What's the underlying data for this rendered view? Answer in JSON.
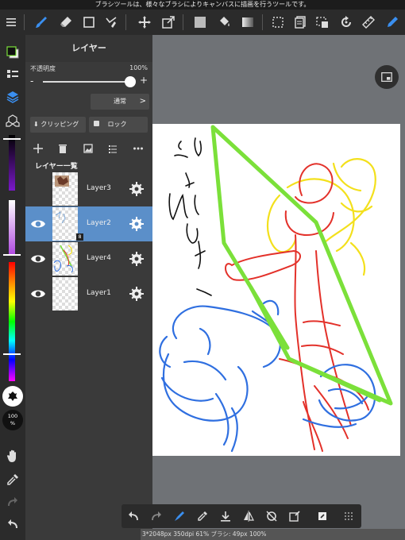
{
  "tooltip": "ブラシツールは、様々なブラシによりキャンバスに描画を行うツールです。",
  "toolbar": {
    "icons": [
      "menu-icon",
      "brush-icon",
      "eraser-icon",
      "rectangle-icon",
      "select-brush-icon",
      "move-icon",
      "transform-icon",
      "fill-color-icon",
      "bucket-icon",
      "gradient-icon",
      "select-rect-icon",
      "copy-icon",
      "select-all-icon",
      "rotate-icon",
      "ruler-icon",
      "pen-blue-icon"
    ]
  },
  "panel": {
    "title": "レイヤー",
    "opacity_label": "不透明度",
    "opacity_value": "100%",
    "opacity_level": 1.0,
    "minus": "-",
    "plus": "+",
    "blend_mode": "通常",
    "blend_chevron": ">",
    "clipping_label": "クリッピング",
    "lock_label": "ロック",
    "list_header": "レイヤー一覧",
    "layers": [
      {
        "name": "Layer3",
        "visible": false,
        "selected": false
      },
      {
        "name": "Layer2",
        "visible": true,
        "selected": true,
        "badge": "8"
      },
      {
        "name": "Layer4",
        "visible": true,
        "selected": false
      },
      {
        "name": "Layer1",
        "visible": true,
        "selected": false
      }
    ]
  },
  "leftcol": {
    "brush_size": "100\n%"
  },
  "status": "3*2048px 350dpi 61% ブラシ: 49px 100%",
  "colors": {
    "accent": "#5b8fc9",
    "toolbar_bg": "#2b2b2b",
    "panel_bg": "#3a3a3a",
    "canvas_bg": "#6f7276",
    "stroke_green": "#7be03a",
    "stroke_red": "#e3312a",
    "stroke_yellow": "#f3e01c",
    "stroke_blue": "#2f6fe0"
  }
}
